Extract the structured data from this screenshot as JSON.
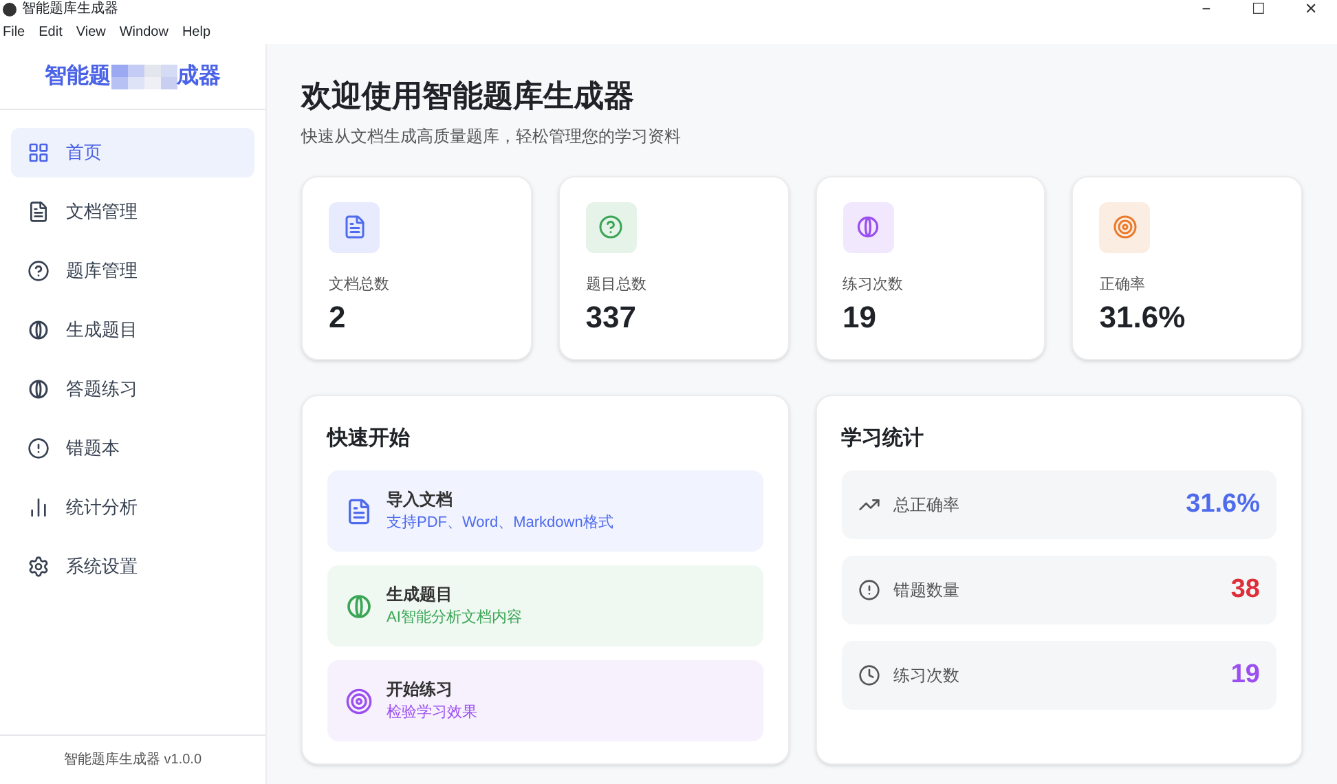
{
  "window": {
    "title": "智能题库生成器",
    "controls": [
      "−",
      "☐",
      "✕"
    ]
  },
  "menu": [
    "File",
    "Edit",
    "View",
    "Window",
    "Help"
  ],
  "sidebar": {
    "title_start": "智能题",
    "title_end": "成器",
    "items": [
      {
        "label": "首页",
        "selected": true
      },
      {
        "label": "文档管理",
        "selected": false
      },
      {
        "label": "题库管理",
        "selected": false
      },
      {
        "label": "生成题目",
        "selected": false
      },
      {
        "label": "答题练习",
        "selected": false
      },
      {
        "label": "错题本",
        "selected": false
      },
      {
        "label": "统计分析",
        "selected": false
      },
      {
        "label": "系统设置",
        "selected": false
      }
    ],
    "footer": "智能题库生成器 v1.0.0"
  },
  "main": {
    "title": "欢迎使用智能题库生成器",
    "subtitle": "快速从文档生成高质量题库，轻松管理您的学习资料",
    "stats": [
      {
        "label": "文档总数",
        "value": "2",
        "color": "#4f6bed"
      },
      {
        "label": "题目总数",
        "value": "337",
        "color": "#3aa655"
      },
      {
        "label": "练习次数",
        "value": "19",
        "color": "#9b4ff0"
      },
      {
        "label": "正确率",
        "value": "31.6%",
        "color": "#ea7a2a"
      }
    ],
    "quick_start": {
      "title": "快速开始",
      "items": [
        {
          "title": "导入文档",
          "description": "支持PDF、Word、Markdown格式",
          "color": "#4f6bed"
        },
        {
          "title": "生成题目",
          "description": "AI智能分析文档内容",
          "color": "#3aa655"
        },
        {
          "title": "开始练习",
          "description": "检验学习效果",
          "color": "#9b4ff0"
        }
      ]
    },
    "learning_stats": {
      "title": "学习统计",
      "items": [
        {
          "label": "总正确率",
          "value": "31.6%",
          "color": "#4f6bed"
        },
        {
          "label": "错题数量",
          "value": "38",
          "color": "#dc2f3a"
        },
        {
          "label": "练习次数",
          "value": "19",
          "color": "#9b4ff0"
        }
      ]
    }
  }
}
